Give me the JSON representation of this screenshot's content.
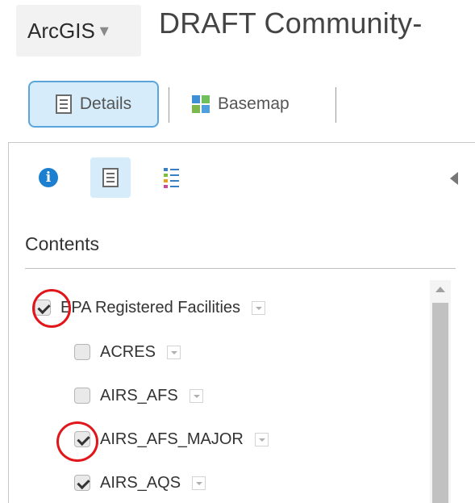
{
  "header": {
    "app_button": "ArcGIS",
    "app_caret": "▾",
    "title": "DRAFT Community-"
  },
  "toolbar": {
    "details_label": "Details",
    "basemap_label": "Basemap"
  },
  "panel": {
    "info_glyph": "i",
    "contents_title": "Contents"
  },
  "layers": [
    {
      "label": "EPA Registered Facilities",
      "checked": true
    },
    {
      "label": "ACRES",
      "checked": false
    },
    {
      "label": "AIRS_AFS",
      "checked": false
    },
    {
      "label": "AIRS_AFS_MAJOR",
      "checked": true
    },
    {
      "label": "AIRS_AQS",
      "checked": true
    }
  ],
  "colors": {
    "accent": "#1d7fd0",
    "selected_bg": "#d6ecfb",
    "annotation": "#e0161b"
  }
}
